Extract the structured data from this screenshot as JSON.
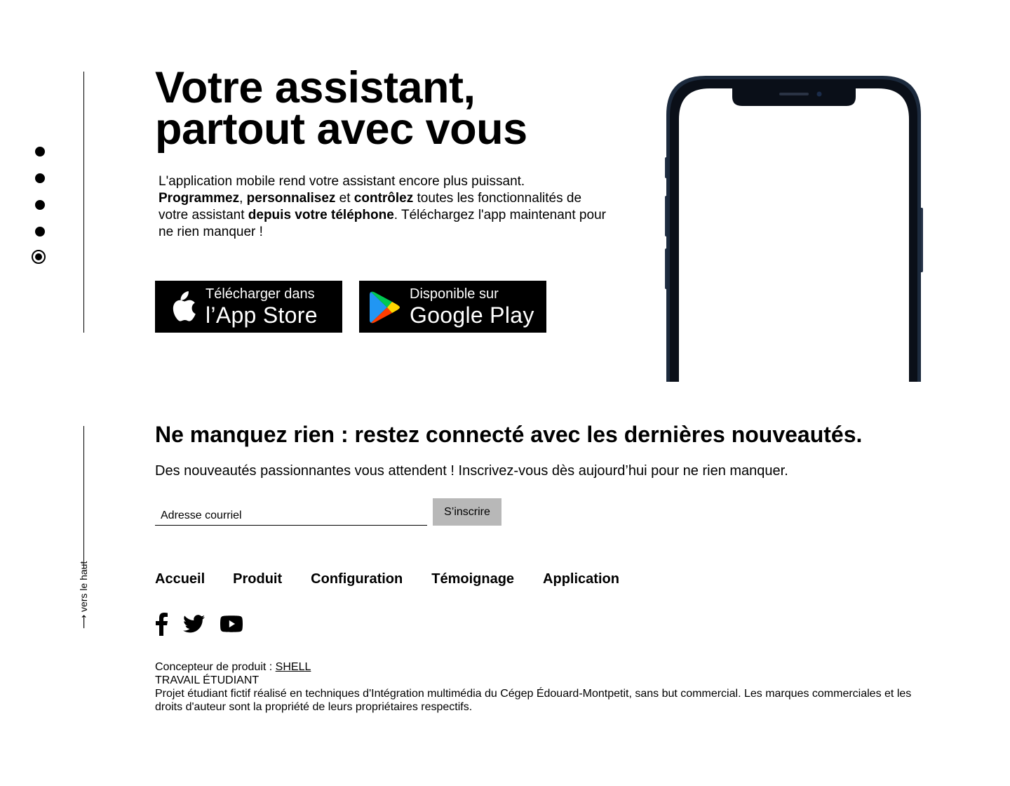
{
  "side_nav": {
    "dots": [
      "section-1",
      "section-2",
      "section-3",
      "section-4",
      "section-5"
    ],
    "active_index": 4
  },
  "hero": {
    "title_line1": "Votre assistant,",
    "title_line2": "partout avec vous",
    "text_1": "L'application mobile rend votre assistant encore plus puissant.",
    "bold_1": "Programmez",
    "sep_1": ", ",
    "bold_2": "personnalisez",
    "sep_2": " et ",
    "bold_3": "contrôlez",
    "text_2": " toutes les fonctionnalités de votre assistant ",
    "bold_4": "depuis votre téléphone",
    "text_3": ". Téléchargez l'app maintenant pour ne rien manquer !"
  },
  "app_store": {
    "small_label": "Télécharger dans",
    "big_label": "l’App Store",
    "icon": "apple-icon"
  },
  "google_play": {
    "small_label": "Disponible sur",
    "big_label": "Google Play",
    "icon": "google-play-icon"
  },
  "newsletter": {
    "title": "Ne manquez rien : restez connecté avec les dernières nouveautés.",
    "subtitle": "Des nouveautés passionnantes vous attendent ! Inscrivez-vous dès aujourd’hui pour ne rien manquer.",
    "email_placeholder": "Adresse courriel",
    "subscribe_label": "S’inscrire"
  },
  "back_to_top": {
    "label": "⟶ vers le haut"
  },
  "footer": {
    "nav": [
      "Accueil",
      "Produit",
      "Configuration",
      "Témoignage",
      "Application"
    ],
    "social": [
      "facebook-icon",
      "twitter-icon",
      "youtube-icon"
    ],
    "designer_label": "Concepteur de produit : ",
    "designer_link": "SHELL",
    "student_work": "TRAVAIL ÉTUDIANT",
    "disclaimer": "Projet étudiant fictif réalisé en techniques d'Intégration multimédia du Cégep Édouard-Montpetit, sans but commercial. Les marques commerciales et les droits d'auteur sont la propriété de leurs propriétaires respectifs."
  },
  "colors": {
    "background": "#ffffff",
    "text": "#000000",
    "button_dark": "#000000",
    "subscribe_button": "#b8b8b8",
    "phone_frame": "#0d1626"
  }
}
